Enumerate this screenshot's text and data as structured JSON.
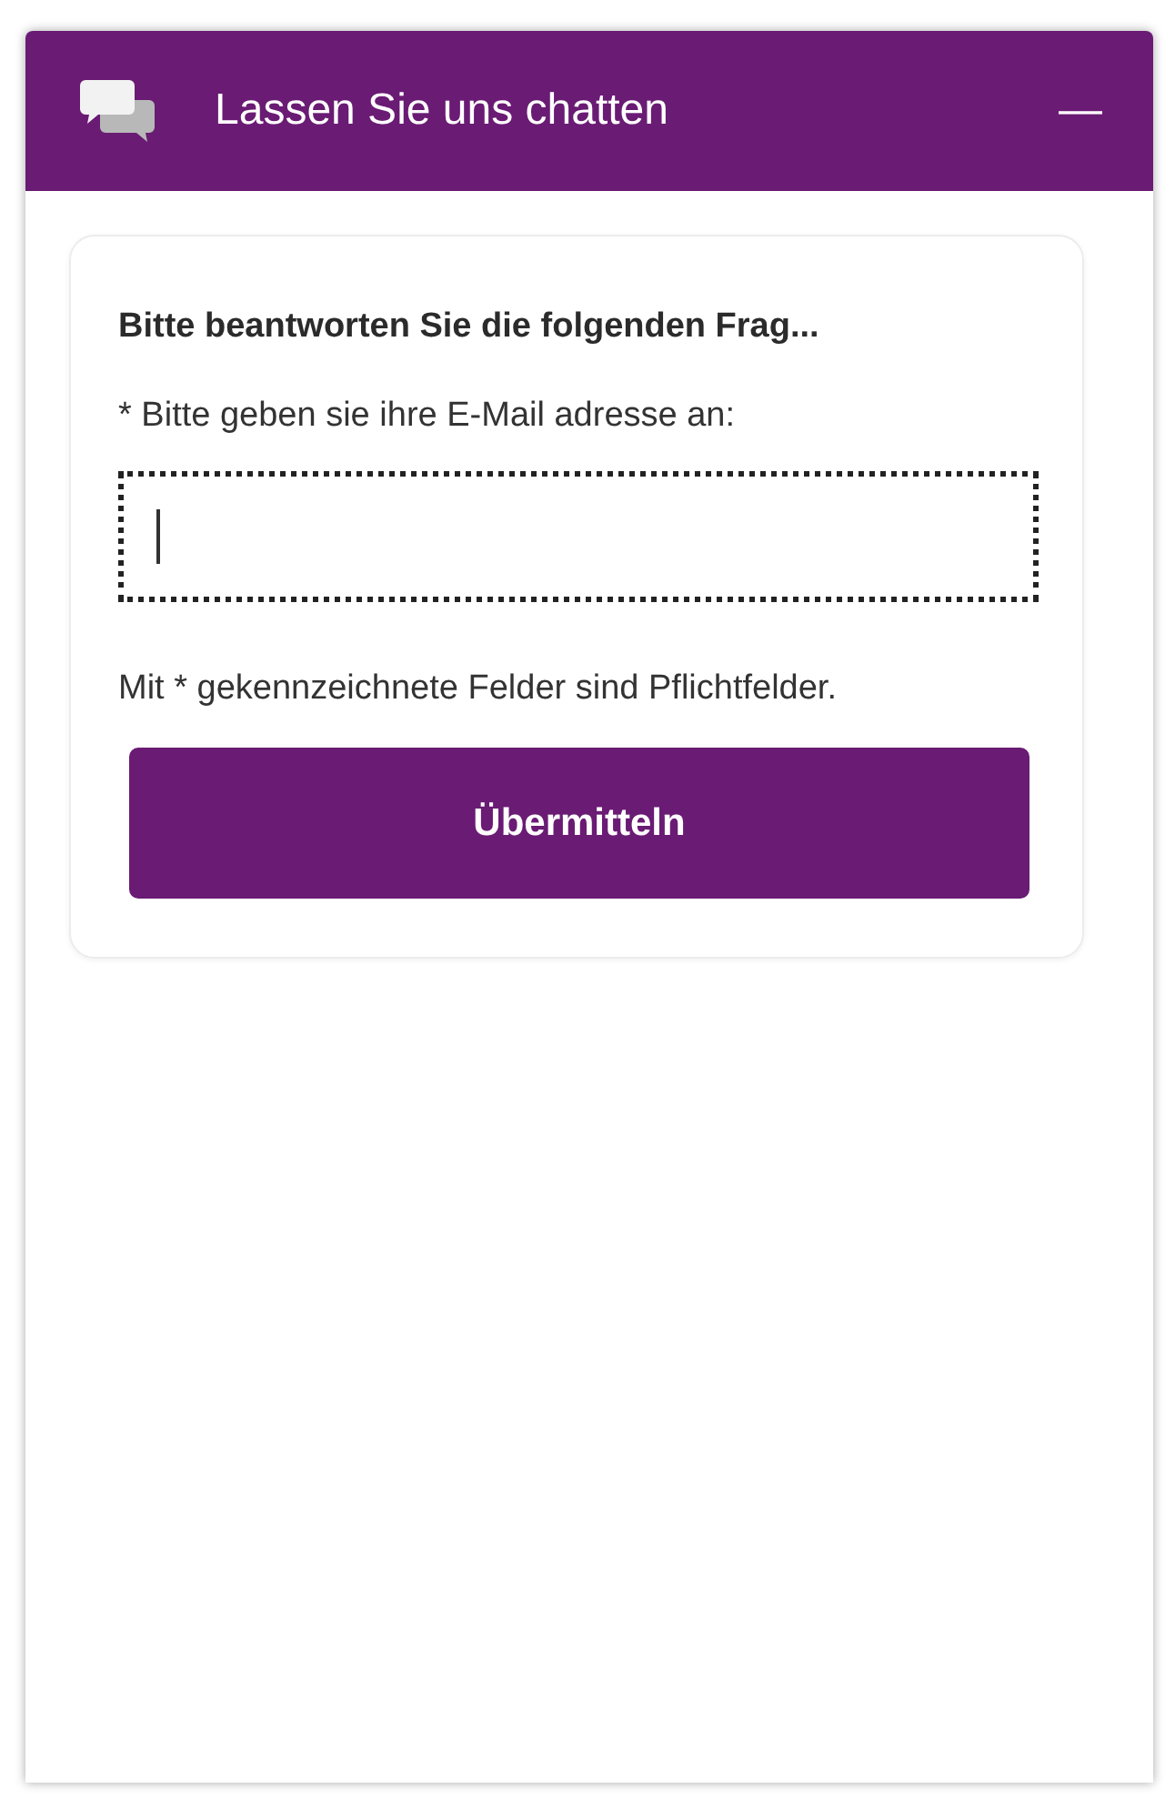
{
  "header": {
    "title": "Lassen Sie uns chatten",
    "minimize": "—"
  },
  "form": {
    "heading": "Bitte beantworten Sie die folgenden Frag...",
    "field_label": "* Bitte geben sie ihre E-Mail adresse an:",
    "email_field": {
      "focused": true
    },
    "note": "Mit * gekennzeichnete Felder sind Pflichtfelder.",
    "submit": "Übermitteln"
  }
}
